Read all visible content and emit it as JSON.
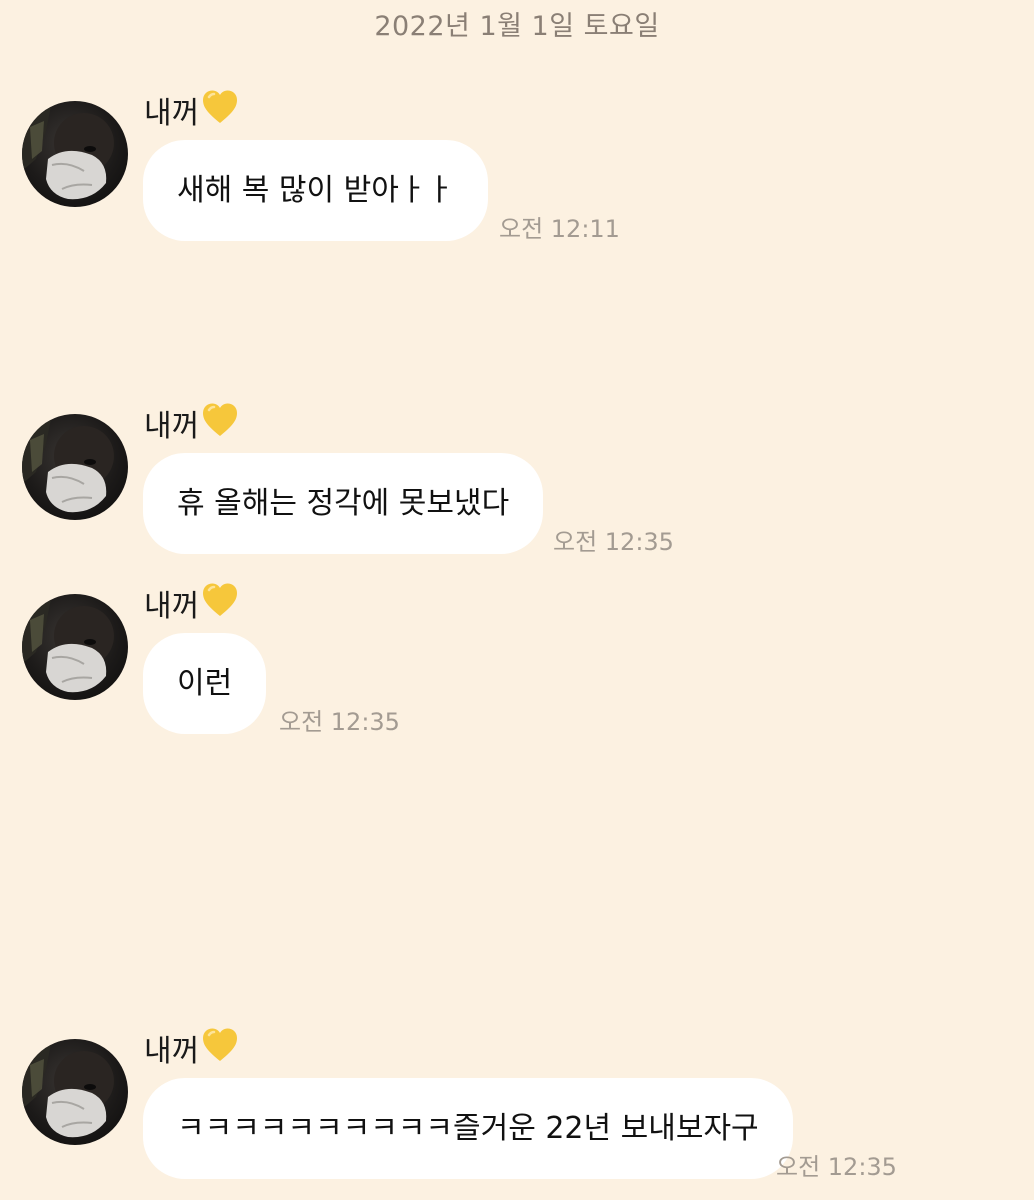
{
  "chat": {
    "date_divider": "2022년 1월 1일 토요일",
    "messages": [
      {
        "sender": "내꺼",
        "text": "새해 복 많이 받아ㅏㅏ",
        "time": "오전 12:11"
      },
      {
        "sender": "내꺼",
        "text": "휴 올해는 정각에 못보냈다",
        "time": "오전 12:35"
      },
      {
        "sender": "내꺼",
        "text": "이런",
        "time": "오전 12:35"
      },
      {
        "sender": "내꺼",
        "text": "ㅋㅋㅋㅋㅋㅋㅋㅋㅋㅋ즐거운 22년 보내보자구",
        "time": "오전 12:35"
      }
    ]
  },
  "colors": {
    "background": "#fcf1e1",
    "bubble": "#ffffff",
    "heart": "#f6c73b",
    "timestamp": "#a39b92"
  },
  "icons": {
    "sender_badge": "yellow-heart-icon"
  }
}
